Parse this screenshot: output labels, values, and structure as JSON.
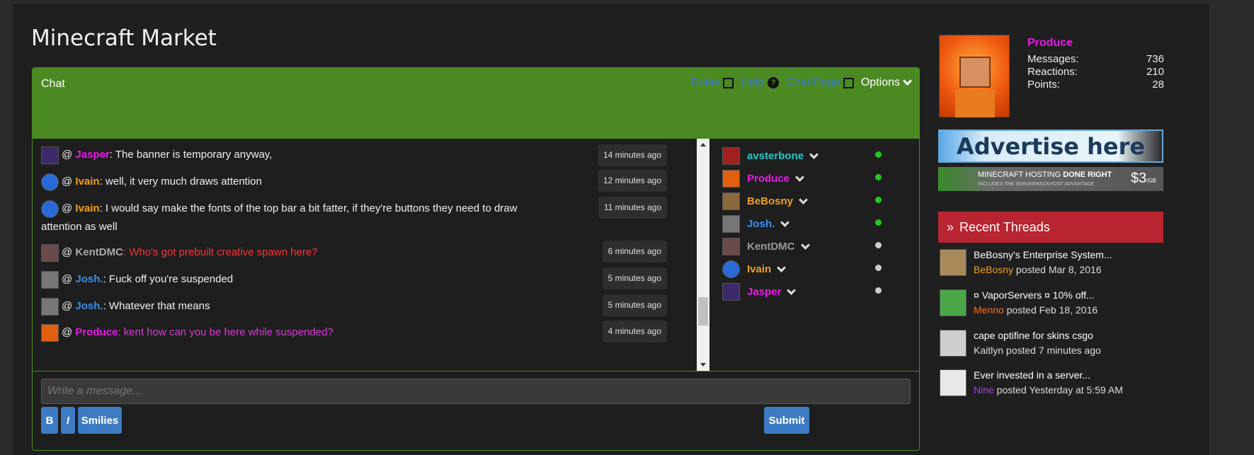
{
  "page": {
    "title": "Minecraft Market"
  },
  "chat": {
    "label": "Chat",
    "links": {
      "rules": "Rules",
      "help": "Help",
      "chat_page": "Chat Page",
      "options": "Options"
    },
    "messages": [
      {
        "user": "Jasper",
        "text": ": The banner is temporary anyway,",
        "text_color": "#f0f0f0",
        "user_color": "#e81ae8",
        "time": "14 minutes ago"
      },
      {
        "user": "Ivain",
        "text": ": well, it very much draws attention",
        "text_color": "#f0f0f0",
        "user_color": "#f0a020",
        "time": "12 minutes ago"
      },
      {
        "user": "Ivain",
        "text": ": I would say make the fonts of the top bar a bit fatter, if they're buttons they need to draw",
        "text2": "attention as well",
        "text_color": "#f0f0f0",
        "user_color": "#f0a020",
        "time": "11 minutes ago"
      },
      {
        "user": "KentDMC",
        "text": ": Who's got prebuilt creative spawn here?",
        "text_color": "#f03a3a",
        "user_color": "#aaaaaa",
        "time": "6 minutes ago"
      },
      {
        "user": "Josh.",
        "text": ": Fuck off you're suspended",
        "text_color": "#f0f0f0",
        "user_color": "#3b8ee8",
        "time": "5 minutes ago"
      },
      {
        "user": "Josh.",
        "text": ": Whatever that means",
        "text_color": "#f0f0f0",
        "user_color": "#3b8ee8",
        "time": "5 minutes ago"
      },
      {
        "user": "Produce",
        "text": ": kent how can you be here while suspended?",
        "text_color": "#d040d0",
        "user_color": "#e81ae8",
        "time": "4 minutes ago"
      }
    ],
    "users": [
      {
        "name": "avsterbone",
        "color": "#22c8c8",
        "status": "#22c822"
      },
      {
        "name": "Produce",
        "color": "#e81ae8",
        "status": "#22c822"
      },
      {
        "name": "BeBosny",
        "color": "#f0a020",
        "status": "#22c822"
      },
      {
        "name": "Josh.",
        "color": "#3b8ee8",
        "status": "#22c822"
      },
      {
        "name": "KentDMC",
        "color": "#999999",
        "status": "#cccccc"
      },
      {
        "name": "Ivain",
        "color": "#f0a020",
        "status": "#cccccc"
      },
      {
        "name": "Jasper",
        "color": "#e81ae8",
        "status": "#cccccc"
      }
    ],
    "input_placeholder": "Write a message...",
    "bold_label": "B",
    "italic_label": "I",
    "smilies_label": "Smilies",
    "submit_label": "Submit"
  },
  "profile": {
    "name": "Produce",
    "stats": [
      {
        "label": "Messages:",
        "value": "736"
      },
      {
        "label": "Reactions:",
        "value": "210"
      },
      {
        "label": "Points:",
        "value": "28"
      }
    ]
  },
  "ads": {
    "ad1": "Advertise here",
    "ad2_main_a": "MINECRAFT HOSTING ",
    "ad2_main_b": "DONE RIGHT",
    "ad2_sub": "INCLUDES THE SERVERRACKHOST ADVANTAGE",
    "ad2_price": "$3",
    "ad2_unit": "/GB"
  },
  "recent_threads": {
    "title": "Recent Threads",
    "items": [
      {
        "title": "BeBosny's Enterprise System...",
        "user": "BeBosny",
        "user_color": "#f0a020",
        "meta": " posted Mar 8, 2016"
      },
      {
        "title": "¤ VaporServers ¤ 10% off...",
        "user": "Menno",
        "user_color": "#f07020",
        "meta": " posted Feb 18, 2016"
      },
      {
        "title": "cape optifine for skins csgo",
        "user": "Kaitlyn",
        "user_color": "#dddddd",
        "meta": " posted 7 minutes ago"
      },
      {
        "title": "Ever invested in a server...",
        "user": "Nine",
        "user_color": "#a040e8",
        "meta": " posted Yesterday at 5:59 AM"
      }
    ]
  }
}
